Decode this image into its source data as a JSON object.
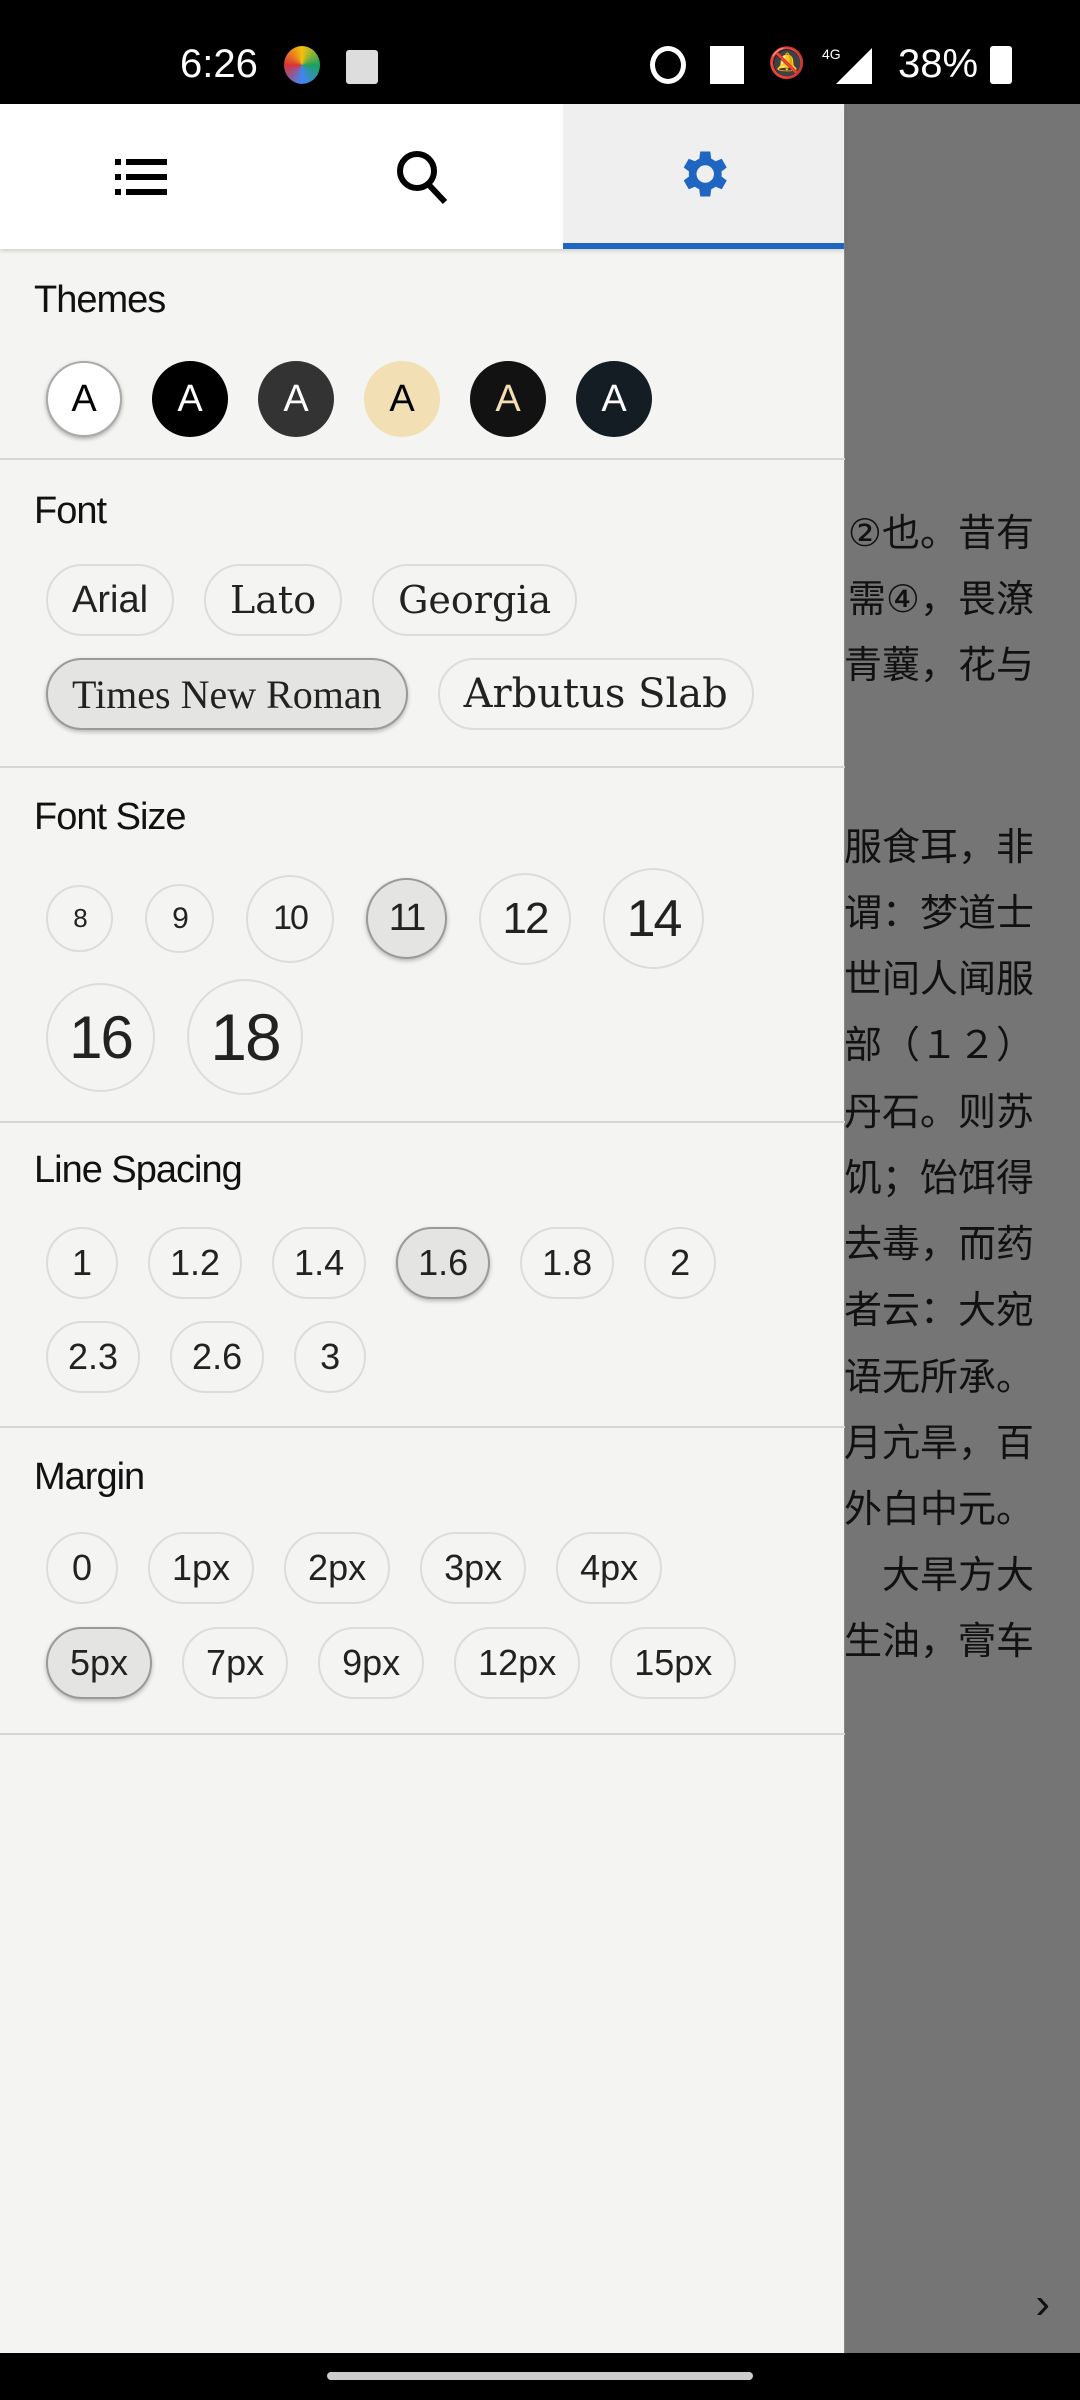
{
  "status_bar": {
    "time": "6:26",
    "battery": "38%",
    "network": "4G",
    "icons": [
      "app-icon",
      "image-icon",
      "alarm-icon",
      "volte-icon",
      "bell-off-icon",
      "signal-icon",
      "battery-icon"
    ]
  },
  "tabs": [
    {
      "name": "list-icon"
    },
    {
      "name": "search-icon"
    },
    {
      "name": "gear-icon",
      "active": true
    }
  ],
  "accent": "#1e66c1",
  "themes": {
    "title": "Themes",
    "items": [
      {
        "label": "A",
        "bg": "#ffffff",
        "fg": "#000000",
        "selected": true
      },
      {
        "label": "A",
        "bg": "#000000",
        "fg": "#ffffff"
      },
      {
        "label": "A",
        "bg": "#333333",
        "fg": "#ffffff"
      },
      {
        "label": "A",
        "bg": "#f3dfb4",
        "fg": "#000000"
      },
      {
        "label": "A",
        "bg": "#121212",
        "fg": "#f3dfb4"
      },
      {
        "label": "A",
        "bg": "#141c24",
        "fg": "#ffffff"
      }
    ]
  },
  "font": {
    "title": "Font",
    "options": [
      "Arial",
      "Lato",
      "Georgia",
      "Times New Roman",
      "Arbutus Slab"
    ],
    "selected": "Times New Roman"
  },
  "font_size": {
    "title": "Font Size",
    "options": [
      "8",
      "9",
      "10",
      "11",
      "12",
      "14",
      "16",
      "18"
    ],
    "selected": "11"
  },
  "line_spacing": {
    "title": "Line Spacing",
    "options": [
      "1",
      "1.2",
      "1.4",
      "1.6",
      "1.8",
      "2",
      "2.3",
      "2.6",
      "3"
    ],
    "selected": "1.6"
  },
  "margin": {
    "title": "Margin",
    "options": [
      "0",
      "1px",
      "2px",
      "3px",
      "4px",
      "5px",
      "7px",
      "9px",
      "12px",
      "15px"
    ],
    "selected": "5px"
  },
  "reader": {
    "lines": [
      "②也。昔有",
      "需④，畏潦",
      "青蘘，花与",
      "",
      "",
      "服食耳，非",
      "谓：梦道士",
      "世间人闻服",
      "部（１２）",
      "丹石。则苏",
      "饥；饴饵得",
      "去毒，而药",
      "者云：大宛",
      "语无所承。",
      "月亢旱，百",
      "外白中元。",
      "　大旱方大",
      "生油，膏车"
    ],
    "next": "›"
  }
}
